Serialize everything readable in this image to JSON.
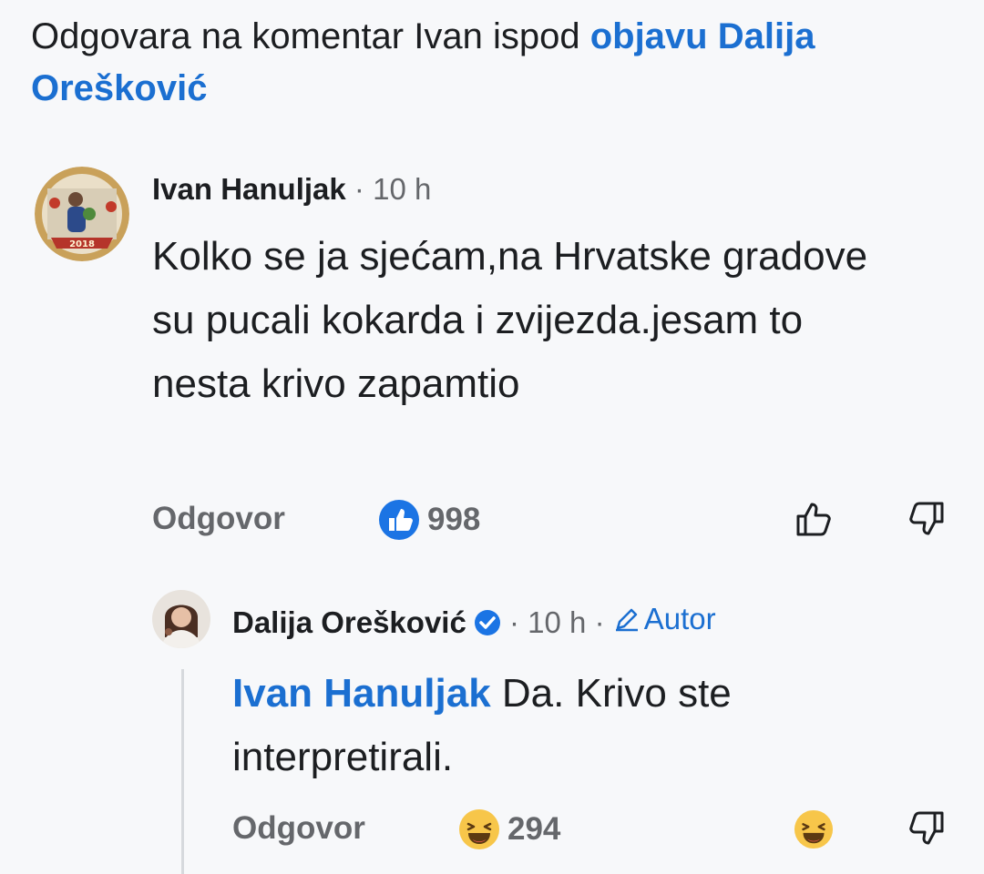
{
  "header": {
    "prefix": "Odgovara na komentar Ivan ispod ",
    "post_link": "objavu Dalija Orešković"
  },
  "comments": [
    {
      "author": "Ivan Hanuljak",
      "time": "10 h",
      "avatar": "avatar-photo-ivan",
      "avatar_badge": "2018",
      "text": "Kolko se ja sjećam,na Hrvatske gradove su pucali kokarda i zvijezda.jesam to nesta krivo zapamtio",
      "reply_label": "Odgovor",
      "reaction_icon": "like-icon",
      "reaction_count": "998",
      "actions": [
        "like-outline-icon",
        "dislike-outline-icon"
      ]
    },
    {
      "author": "Dalija Orešković",
      "verified": true,
      "time": "10 h",
      "author_badge": "Autor",
      "avatar": "avatar-photo-dalija",
      "mention": "Ivan Hanuljak",
      "text": " Da. Krivo ste interpretirali.",
      "reply_label": "Odgovor",
      "reaction_icon": "haha-icon",
      "reaction_count": "294",
      "actions": [
        "haha-icon",
        "dislike-outline-icon"
      ]
    }
  ],
  "colors": {
    "background": "#f7f8fa",
    "link_blue": "#1b6fd1",
    "secondary_text": "#65676b",
    "primary_text": "#1c1e21",
    "haha_yellow": "#f7c64a"
  }
}
